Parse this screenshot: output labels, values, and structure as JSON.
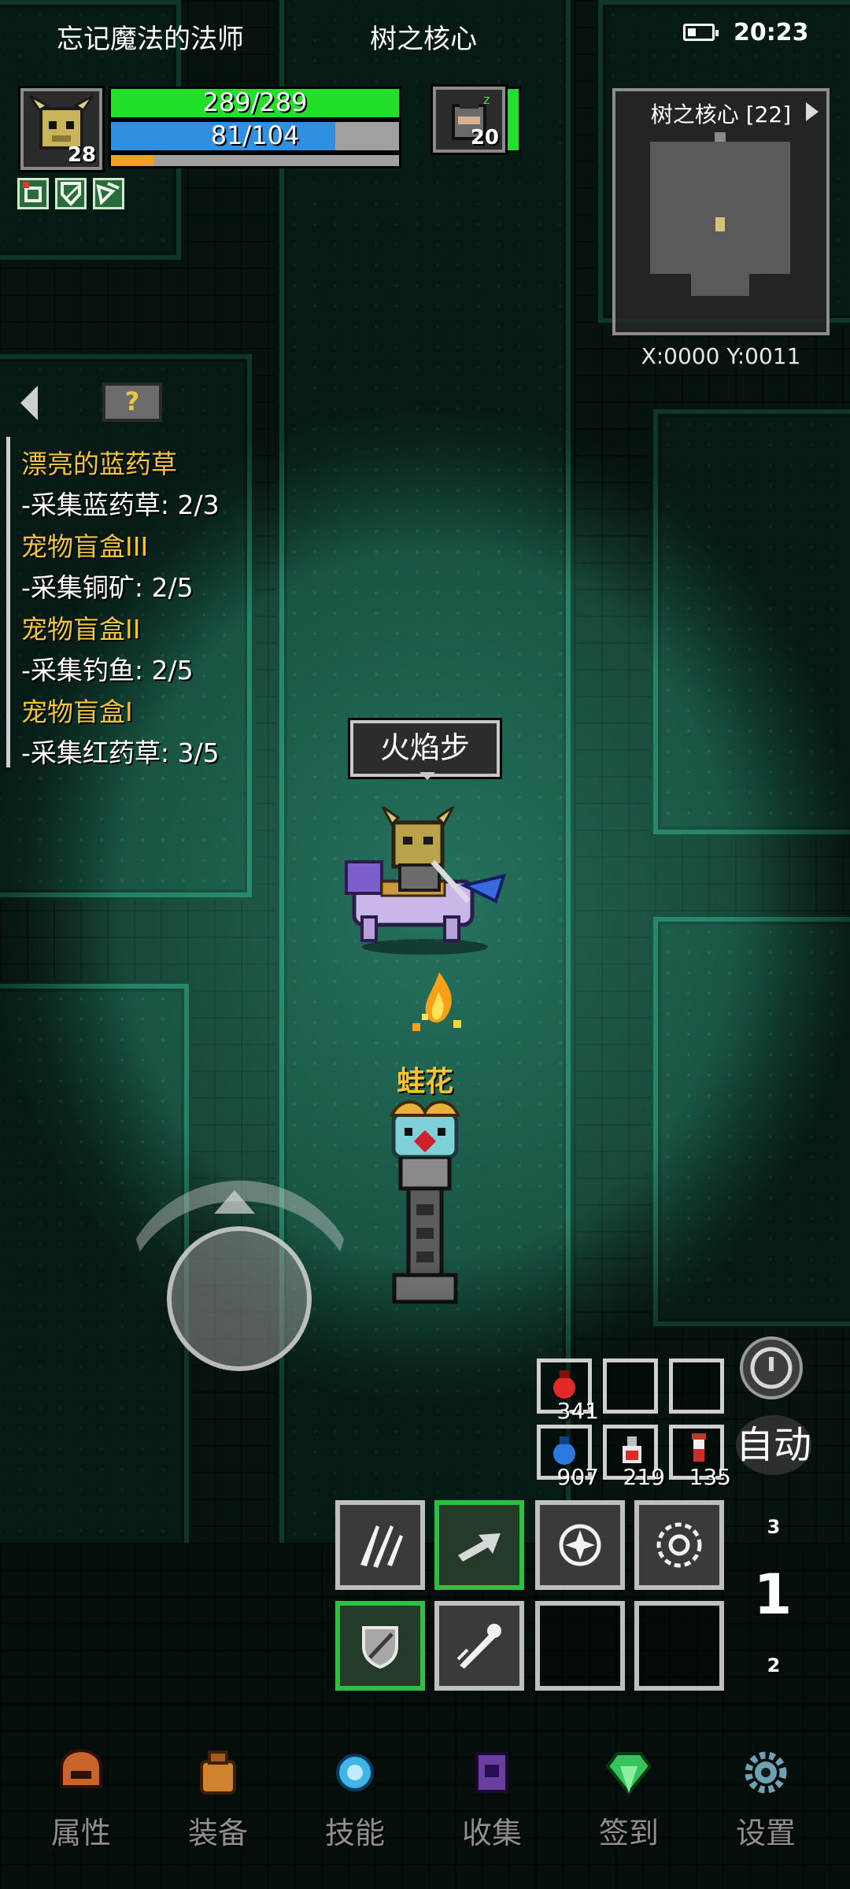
{
  "status_bar": {
    "game_title": "忘记魔法的法师",
    "location": "树之核心",
    "time": "20:23"
  },
  "player": {
    "level": "28",
    "hp_text": "289/289",
    "hp_fraction": 1.0,
    "mp_text": "81/104",
    "mp_fraction": 0.78,
    "exp_fraction": 0.15,
    "buff_icons": [
      "skull-buff-icon",
      "shield-buff-icon",
      "wing-buff-icon"
    ]
  },
  "pet": {
    "level": "20",
    "hp_fraction": 1.0,
    "status_icon": "sleep-zz-icon"
  },
  "minimap": {
    "title": "树之核心 [22]",
    "coords": "X:0000  Y:0011"
  },
  "quests": [
    {
      "title": "漂亮的蓝药草",
      "objective": "-采集蓝药草: 2/3"
    },
    {
      "title": "宠物盲盒III",
      "objective": "-采集铜矿: 2/5"
    },
    {
      "title": "宠物盲盒II",
      "objective": "-采集钓鱼: 2/5"
    },
    {
      "title": "宠物盲盒I",
      "objective": "-采集红药草: 3/5"
    }
  ],
  "scene": {
    "skill_bubble": "火焰步",
    "pet_name": "蛙花"
  },
  "items": [
    {
      "icon": "red-potion-icon",
      "count": "341"
    },
    {
      "icon": "",
      "count": ""
    },
    {
      "icon": "",
      "count": ""
    },
    {
      "icon": "blue-potion-icon",
      "count": "907"
    },
    {
      "icon": "red-flask-icon",
      "count": "219"
    },
    {
      "icon": "health-vial-icon",
      "count": "135"
    }
  ],
  "skills": [
    {
      "icon": "claw-slash-icon",
      "active": false
    },
    {
      "icon": "dash-arrow-icon",
      "active": true
    },
    {
      "icon": "burst-star-icon",
      "active": false
    },
    {
      "icon": "gear-burst-icon",
      "active": false
    },
    {
      "icon": "shield-icon",
      "active": true
    },
    {
      "icon": "meteor-icon",
      "active": false
    },
    {
      "icon": "",
      "active": false
    },
    {
      "icon": "",
      "active": false
    }
  ],
  "controls": {
    "auto_label": "自动",
    "page_up": "3",
    "page_current": "1",
    "page_down": "2"
  },
  "nav": [
    {
      "label": "属性",
      "icon": "helmet-icon",
      "color": "#c8642c"
    },
    {
      "label": "装备",
      "icon": "backpack-icon",
      "color": "#d0822e"
    },
    {
      "label": "技能",
      "icon": "orb-icon",
      "color": "#3fb4e8"
    },
    {
      "label": "收集",
      "icon": "book-icon",
      "color": "#6a3fa0"
    },
    {
      "label": "签到",
      "icon": "gem-icon",
      "color": "#38c45c"
    },
    {
      "label": "设置",
      "icon": "gear-icon",
      "color": "#6fa0b4"
    }
  ],
  "colors": {
    "hp": "#22e02a",
    "mp": "#2f8fe0",
    "exp": "#f0a020",
    "quest_title": "#f0c53a"
  }
}
